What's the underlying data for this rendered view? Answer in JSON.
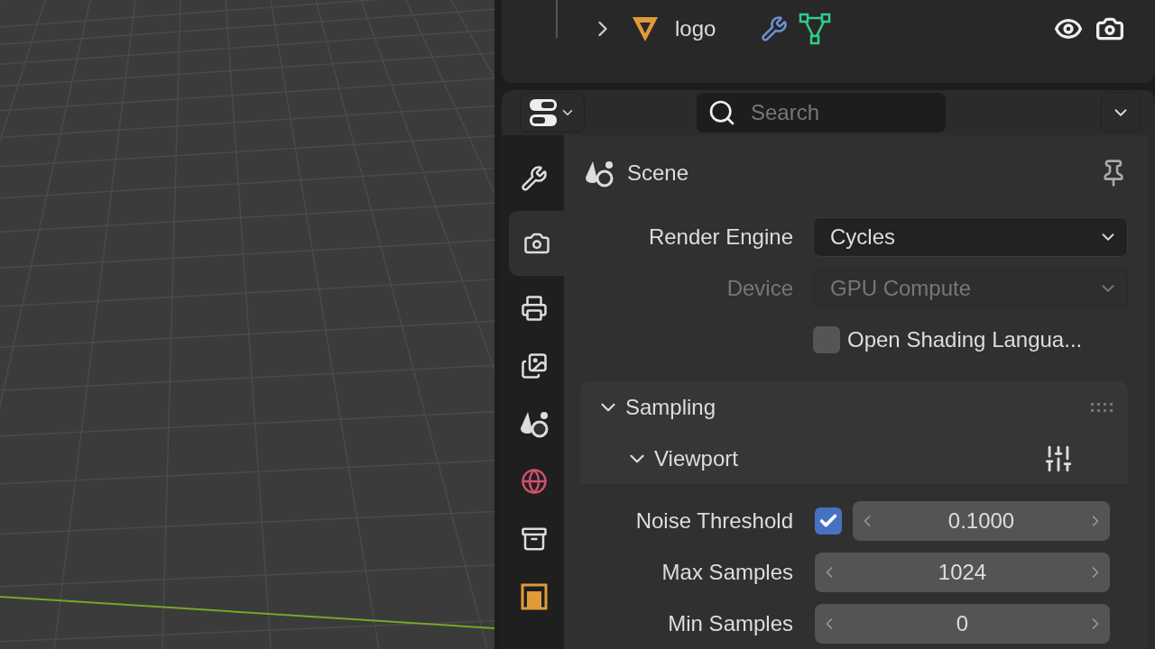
{
  "outliner": {
    "rows": [
      {
        "name": "logo",
        "expanded": false
      }
    ]
  },
  "properties": {
    "search": {
      "placeholder": "Search"
    },
    "tabs": [
      {
        "kind": "tool",
        "selected": false
      },
      {
        "kind": "render",
        "selected": true
      },
      {
        "kind": "output",
        "selected": false
      },
      {
        "kind": "view_layer",
        "selected": false
      },
      {
        "kind": "scene",
        "selected": false
      },
      {
        "kind": "world",
        "selected": false
      },
      {
        "kind": "collection",
        "selected": false
      },
      {
        "kind": "object",
        "selected": false
      }
    ],
    "context": {
      "title": "Scene"
    },
    "fields": [
      {
        "kind": "dropdown",
        "label": "Render Engine",
        "value": "Cycles",
        "disabled": false
      },
      {
        "kind": "dropdown",
        "label": "Device",
        "value": "GPU Compute",
        "disabled": true
      },
      {
        "kind": "checkbox",
        "label": "Open Shading Langua...",
        "checked": false
      }
    ],
    "panels": [
      {
        "title": "Sampling",
        "expanded": true,
        "subpanels": [
          {
            "title": "Viewport",
            "expanded": true,
            "fields": [
              {
                "kind": "toggled_number",
                "label": "Noise Threshold",
                "value": "0.1000",
                "checked": true
              },
              {
                "kind": "number",
                "label": "Max Samples",
                "value": "1024"
              },
              {
                "kind": "number",
                "label": "Min Samples",
                "value": "0"
              }
            ]
          }
        ]
      }
    ]
  }
}
